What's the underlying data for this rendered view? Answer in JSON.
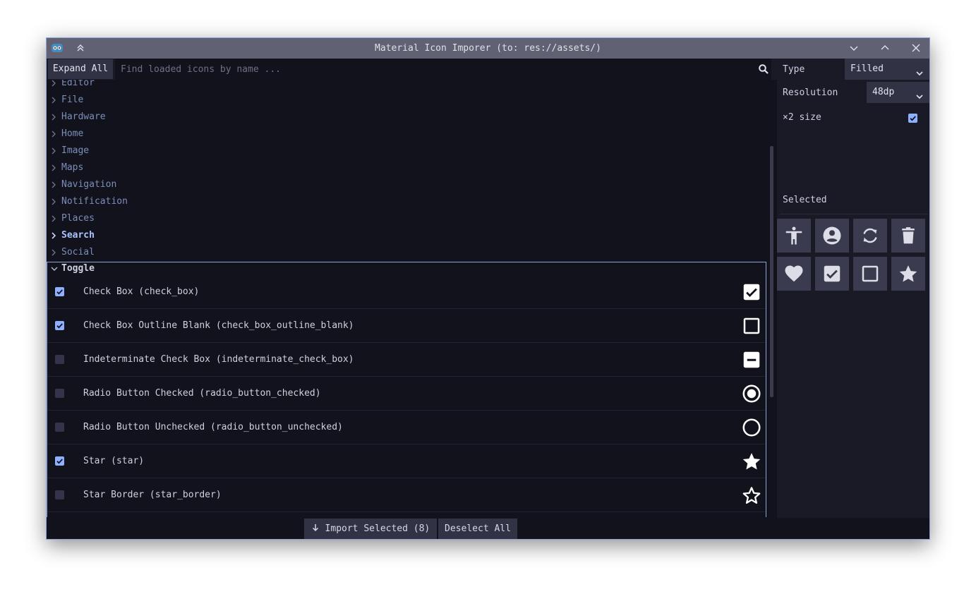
{
  "window": {
    "title": "Material Icon Imporer (to: res://assets/)",
    "accent": "#8fb0ff",
    "background": "#12121c"
  },
  "toolbar": {
    "expand_label": "Expand All",
    "search_placeholder": "Find loaded icons by name ..."
  },
  "categories": [
    {
      "label": "Editor"
    },
    {
      "label": "File"
    },
    {
      "label": "Hardware"
    },
    {
      "label": "Home"
    },
    {
      "label": "Image"
    },
    {
      "label": "Maps"
    },
    {
      "label": "Navigation"
    },
    {
      "label": "Notification"
    },
    {
      "label": "Places"
    },
    {
      "label": "Search"
    },
    {
      "label": "Social"
    }
  ],
  "toggle_group": {
    "label": "Toggle",
    "items": [
      {
        "label": "Check Box (check_box)",
        "checked": true,
        "icon": "check-box-icon"
      },
      {
        "label": "Check Box Outline Blank (check_box_outline_blank)",
        "checked": true,
        "icon": "check-box-outline-blank-icon"
      },
      {
        "label": "Indeterminate Check Box (indeterminate_check_box)",
        "checked": false,
        "icon": "indeterminate-check-box-icon"
      },
      {
        "label": "Radio Button Checked (radio_button_checked)",
        "checked": false,
        "icon": "radio-button-checked-icon"
      },
      {
        "label": "Radio Button Unchecked (radio_button_unchecked)",
        "checked": false,
        "icon": "radio-button-unchecked-icon"
      },
      {
        "label": "Star (star)",
        "checked": true,
        "icon": "star-icon"
      },
      {
        "label": "Star Border (star_border)",
        "checked": false,
        "icon": "star-border-icon"
      }
    ]
  },
  "actions": {
    "import_label": "Import Selected (8)",
    "deselect_label": "Deselect All"
  },
  "settings": {
    "type_label": "Type",
    "type_value": "Filled",
    "resolution_label": "Resolution",
    "resolution_value": "48dp",
    "double_size_label": "×2 size",
    "double_size_checked": true
  },
  "selected": {
    "label": "Selected",
    "icons": [
      "accessibility-icon",
      "account-circle-icon",
      "sync-icon",
      "delete-icon",
      "favorite-icon",
      "check-box-icon",
      "check-box-outline-blank-icon",
      "star-icon"
    ]
  }
}
